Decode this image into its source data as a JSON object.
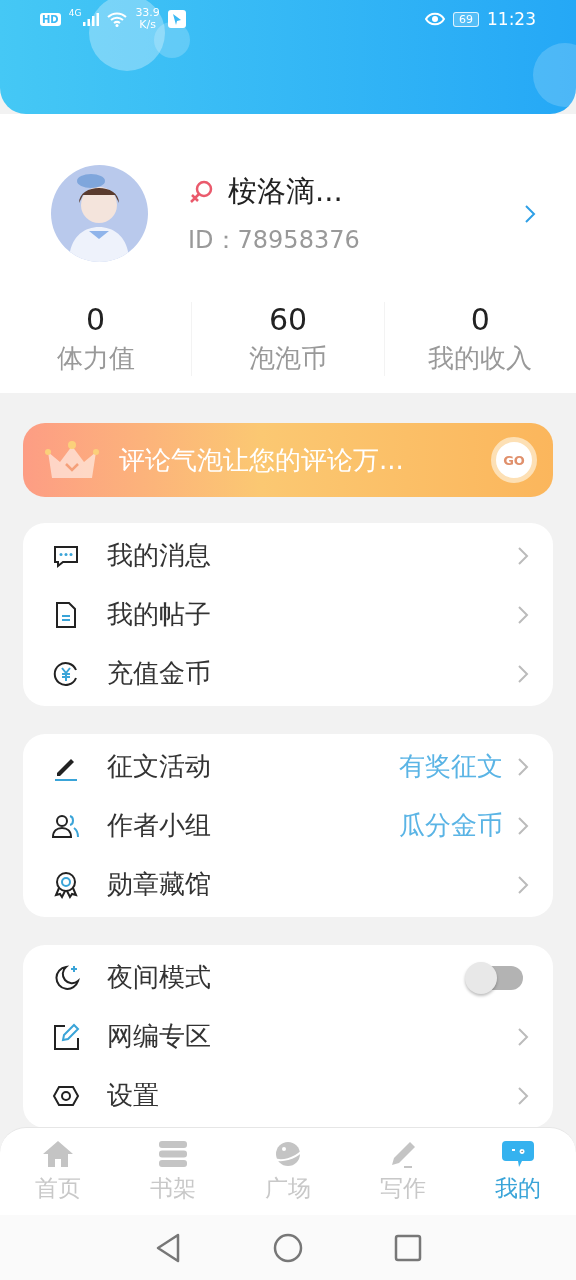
{
  "status_bar": {
    "hd": "HD",
    "network": "4G",
    "speed": "33.9",
    "speed_unit": "K/s",
    "battery": "69",
    "time": "11:23"
  },
  "profile": {
    "name": "桉洛滴...",
    "id": "ID：78958376"
  },
  "stats": [
    {
      "value": "0",
      "label": "体力值"
    },
    {
      "value": "60",
      "label": "泡泡币"
    },
    {
      "value": "0",
      "label": "我的收入"
    }
  ],
  "banner": {
    "text": "评论气泡让您的评论万...",
    "button": "GO"
  },
  "groups": [
    [
      {
        "kind": "link",
        "label": "我的消息"
      },
      {
        "kind": "link",
        "label": "我的帖子"
      },
      {
        "kind": "link",
        "label": "充值金币"
      }
    ],
    [
      {
        "kind": "link",
        "label": "征文活动",
        "badge": "有奖征文"
      },
      {
        "kind": "link",
        "label": "作者小组",
        "badge": "瓜分金币"
      },
      {
        "kind": "link",
        "label": "勋章藏馆"
      }
    ],
    [
      {
        "kind": "toggle",
        "label": "夜间模式",
        "on": false
      },
      {
        "kind": "link",
        "label": "网编专区"
      },
      {
        "kind": "link",
        "label": "设置"
      }
    ]
  ],
  "tabs": [
    {
      "label": "首页",
      "selected": false
    },
    {
      "label": "书架",
      "selected": false
    },
    {
      "label": "广场",
      "selected": false
    },
    {
      "label": "写作",
      "selected": false
    },
    {
      "label": "我的",
      "selected": true
    }
  ]
}
